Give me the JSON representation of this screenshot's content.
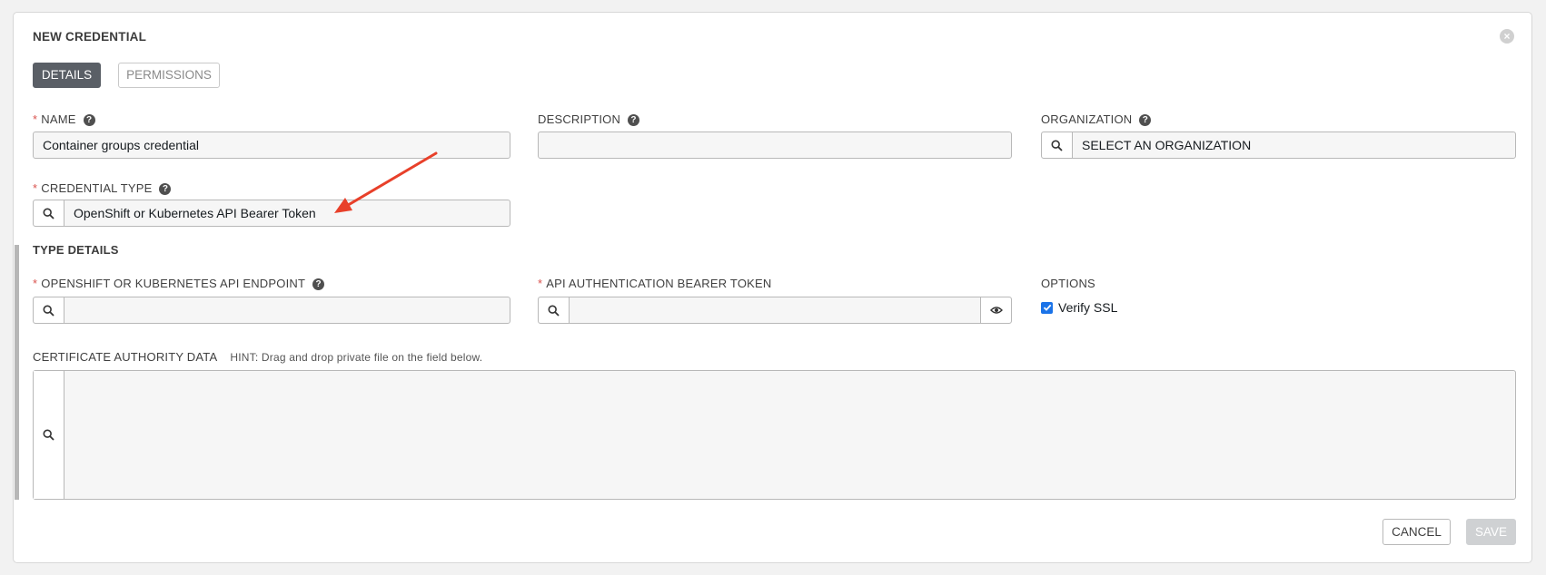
{
  "dialog": {
    "title": "NEW CREDENTIAL",
    "close_icon": "close-icon"
  },
  "tabs": [
    {
      "label": "DETAILS",
      "active": true
    },
    {
      "label": "PERMISSIONS",
      "active": false
    }
  ],
  "fields": {
    "name": {
      "label": "NAME",
      "required": true,
      "value": "Container groups credential"
    },
    "description": {
      "label": "DESCRIPTION",
      "required": false,
      "value": ""
    },
    "organization": {
      "label": "ORGANIZATION",
      "required": false,
      "value": "SELECT AN ORGANIZATION"
    },
    "credential_type": {
      "label": "CREDENTIAL TYPE",
      "required": true,
      "value": "OpenShift or Kubernetes API Bearer Token"
    }
  },
  "type_details": {
    "title": "TYPE DETAILS",
    "api_endpoint": {
      "label": "OPENSHIFT OR KUBERNETES API ENDPOINT",
      "required": true,
      "value": ""
    },
    "bearer_token": {
      "label": "API AUTHENTICATION BEARER TOKEN",
      "required": true,
      "value": ""
    },
    "options": {
      "label": "OPTIONS",
      "verify_ssl_label": "Verify SSL",
      "verify_ssl_checked": true
    },
    "ca_data": {
      "label": "CERTIFICATE AUTHORITY DATA",
      "hint": "HINT: Drag and drop private file on the field below.",
      "value": ""
    }
  },
  "buttons": {
    "cancel": "CANCEL",
    "save": "SAVE"
  },
  "colors": {
    "required_star": "#d9534f",
    "active_tab": "#5a5f66",
    "annotation_arrow": "#e8402a",
    "checkbox": "#1a73e8"
  }
}
